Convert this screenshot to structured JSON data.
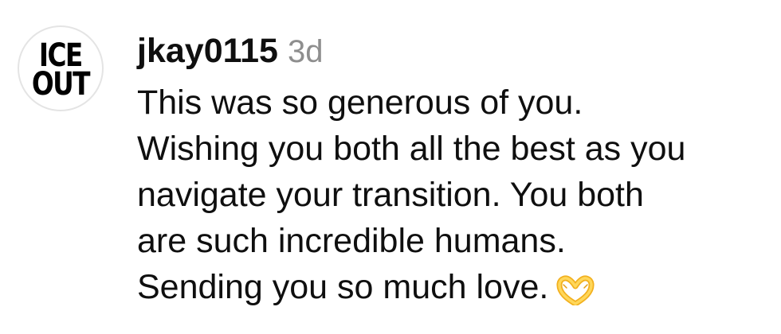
{
  "avatar": {
    "line1": "ICE",
    "line2": "OUT"
  },
  "comment": {
    "username": "jkay0115",
    "timestamp": "3d",
    "lines": [
      "This was so generous of you.",
      "Wishing you both all the best as you",
      "navigate your transition. You both",
      "are such incredible humans.",
      "Sending you so much love."
    ],
    "emoji_icon": "heart-hands-icon"
  },
  "colors": {
    "text": "#0f0f0f",
    "timestamp": "#8e8e8e",
    "emoji": "#f7c33b"
  }
}
